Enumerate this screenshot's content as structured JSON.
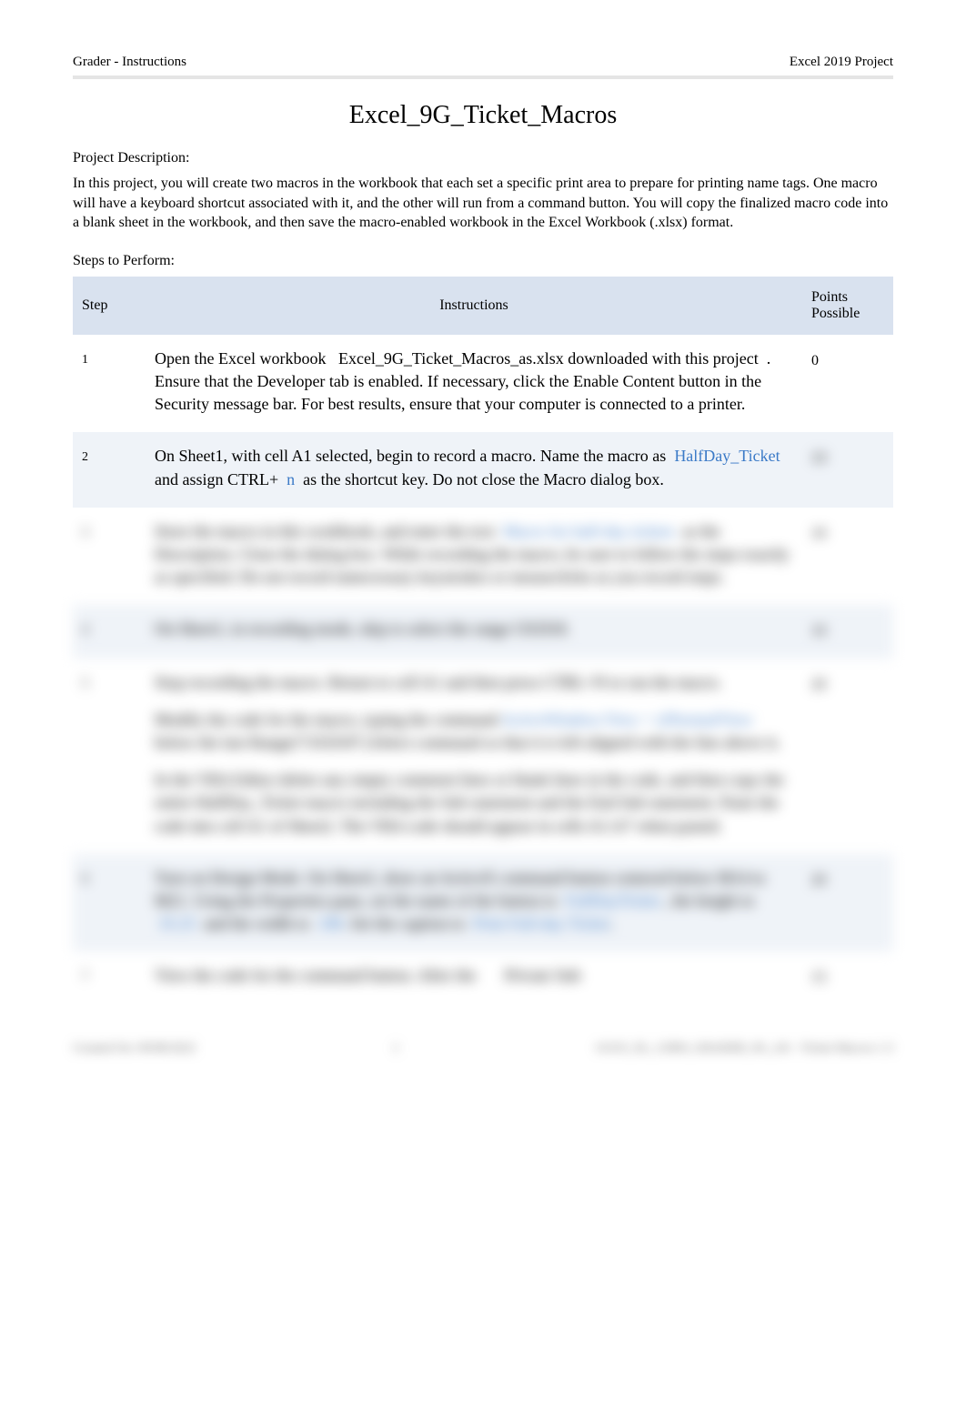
{
  "header": {
    "left": "Grader - Instructions",
    "right": "Excel 2019 Project"
  },
  "title": "Excel_9G_Ticket_Macros",
  "project_description": {
    "label": "Project Description:",
    "text": "In this project, you will create two macros in the workbook that each set a specific print area to prepare for printing name tags. One macro will have a keyboard shortcut associated with it, and the other will run from a command button. You will copy the finalized macro code into a blank sheet in the workbook, and then save the macro-enabled workbook in the Excel Workbook (.xlsx) format."
  },
  "steps_label": "Steps to Perform:",
  "table": {
    "headers": {
      "step": "Step",
      "instructions": "Instructions",
      "points": "Points Possible"
    },
    "rows": [
      {
        "step": "1",
        "points": "0",
        "instr": {
          "p1a": "Open the Excel workbook ",
          "p1b": "Excel_9G_Ticket_Macros_as.xlsx",
          "p1c": " downloaded with this project",
          "p1d": ". Ensure that the Developer tab is enabled. If necessary, click the Enable Content button in the Security message bar. For best results, ensure that your computer is connected to a printer."
        }
      },
      {
        "step": "2",
        "points": "10",
        "instr": {
          "p1a": "On Sheet1, with cell A1 selected, begin to record a macro. Name the macro as ",
          "h1": "HalfDay_Ticket",
          "p1b": " and assign CTRL+ ",
          "h2": "n",
          "p1c": " as the shortcut key. Do not close the Macro dialog box."
        }
      },
      {
        "step": "3",
        "points": "10",
        "instr": {
          "p1a": "Store the macro in this workbook, and enter the text ",
          "h1": "Macro for half-day tickets",
          "p1b": " as the Description. Close the dialog box. While recording the macro, be sure to follow the steps exactly as specified. Do not record unnecessary keystrokes or mouseclicks as you record steps."
        }
      },
      {
        "step": "4",
        "points": "10",
        "instr": {
          "p1a": "On Sheet1, in recording mode, skip to select the range C8:D18."
        }
      },
      {
        "step": "5",
        "points": "20",
        "instr": {
          "p1a": "Stop recording the macro. Return to cell A1 and then press CTRL+N to run the macro.",
          "p2a": "Modify the code for the macro, typing the command ",
          "h1": "ActiveWindow.View = xlNormalView",
          "p2b": " below the last Range(\"C8:D18\").Select command so that it is left aligned with the line above it.",
          "p3a": "In the VBA Editor delete any empty comment lines or blank lines in the code, and then copy the entire HalfDay_Ticket macro including the Sub statement and the End Sub statement. Paste the code into cell A1 of Sheet2. The VBA code should appear in cells A1:A7 when pasted."
        }
      },
      {
        "step": "6",
        "points": "20",
        "instr": {
          "p1a": "Turn on Design Mode. On Sheet1, draw an ActiveX command button centered below M14 to M21. Using the Properties pane, set the name of the button to ",
          "h1": "FullDayTicket",
          "p1b": ", the height to ",
          "h2": "35.25",
          "p1c": " and the width to ",
          "h3": "108",
          "p1d": ". Set the caption to ",
          "h4": "Print Full-day Ticket",
          "p1e": "."
        }
      },
      {
        "step": "7",
        "points": "15",
        "instr": {
          "p1a": "View the code for the command button. After the ",
          "p1b": "Private Sub"
        }
      }
    ]
  },
  "footer": {
    "left": "Created On: 09/08/2022",
    "center": "1",
    "right": "GO19_XL_CH09_GRADER_9G_AS - Ticket Macros 1.3"
  }
}
